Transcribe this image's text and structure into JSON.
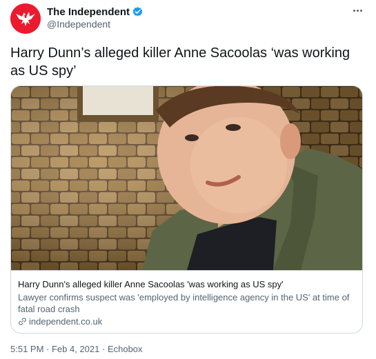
{
  "author": {
    "display_name": "The Independent",
    "handle": "@Independent",
    "avatar_icon": "eagle-logo-icon",
    "verified_icon": "verified-badge-icon",
    "brand_color": "#ec1a2e"
  },
  "tweet": {
    "text": "Harry Dunn’s alleged killer Anne Sacoolas ‘was working as US spy’"
  },
  "card": {
    "title": "Harry Dunn's alleged killer Anne Sacoolas 'was working as US spy'",
    "description": "Lawyer confirms suspect was 'employed by intelligence agency in the US' at time of fatal road crash",
    "domain": "independent.co.uk",
    "link_icon": "link-icon"
  },
  "meta": {
    "time": "5:51 PM",
    "separator1": " · ",
    "date": "Feb 4, 2021",
    "separator2": " · ",
    "source": "Echobox"
  },
  "colors": {
    "text_primary": "#0f1419",
    "text_secondary": "#536471",
    "verified_blue": "#1d9bf0",
    "border": "#cfd9de"
  }
}
